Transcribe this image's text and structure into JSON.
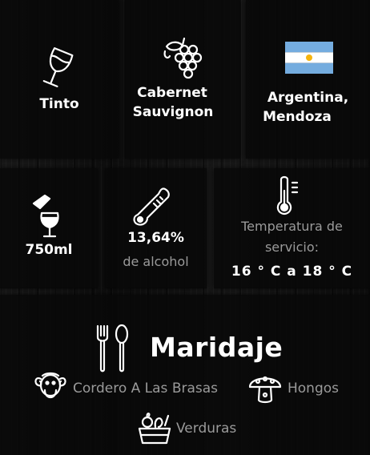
{
  "features": {
    "type": {
      "label": "Tinto",
      "icon": "wine-glass-icon"
    },
    "grape": {
      "label_line1": "Cabernet",
      "label_line2": "Sauvignon",
      "icon": "grapes-icon"
    },
    "origin": {
      "label_line1": "Argentina,",
      "label_line2": "Mendoza",
      "icon": "argentina-flag-icon"
    }
  },
  "specs": {
    "volume": {
      "label": "750ml",
      "icon": "bottle-pour-icon"
    },
    "alcohol": {
      "value": "13,64%",
      "caption": "de alcohol",
      "icon": "thermometer-icon"
    },
    "temperature": {
      "caption_line1": "Temperatura de",
      "caption_line2": "servicio:",
      "value": "16 ° C a 18 ° C",
      "icon": "temperature-icon"
    }
  },
  "pairing": {
    "title": "Maridaje",
    "items": [
      {
        "label": "Cordero A Las Brasas",
        "icon": "lamb-icon"
      },
      {
        "label": "Hongos",
        "icon": "mushroom-icon"
      },
      {
        "label": "Verduras",
        "icon": "vegetable-basket-icon"
      }
    ]
  },
  "colors": {
    "flag_blue": "#74ACDF",
    "flag_sun": "#F6B40E",
    "muted_text": "#9a9a9a"
  }
}
